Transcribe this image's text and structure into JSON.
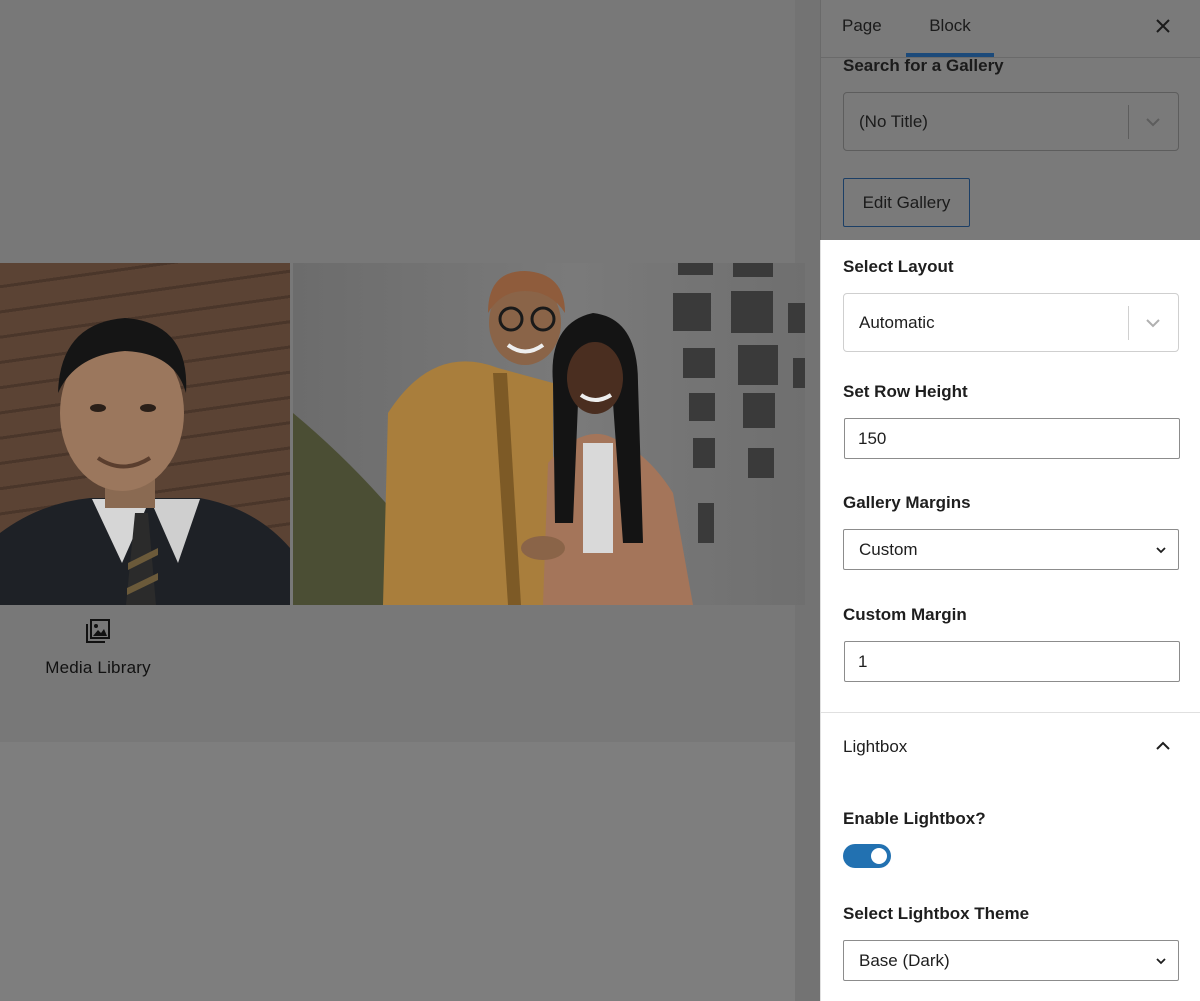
{
  "canvas": {
    "media_library_label": "Media Library"
  },
  "sidebar": {
    "tabs": [
      {
        "label": "Page",
        "active": false
      },
      {
        "label": "Block",
        "active": true
      }
    ],
    "search_gallery": {
      "label": "Search for a Gallery",
      "value": "(No Title)"
    },
    "edit_gallery_label": "Edit Gallery",
    "layout": {
      "label": "Select Layout",
      "value": "Automatic"
    },
    "row_height": {
      "label": "Set Row Height",
      "value": "150"
    },
    "gallery_margins": {
      "label": "Gallery Margins",
      "value": "Custom"
    },
    "custom_margin": {
      "label": "Custom Margin",
      "value": "1"
    },
    "lightbox": {
      "section_title": "Lightbox",
      "enable_label": "Enable Lightbox?",
      "enabled": true,
      "theme_label": "Select Lightbox Theme",
      "theme_value": "Base (Dark)"
    }
  },
  "colors": {
    "accent": "#2271b1",
    "overlay": "#7a7a7a",
    "panel_bg": "#ffffff"
  }
}
